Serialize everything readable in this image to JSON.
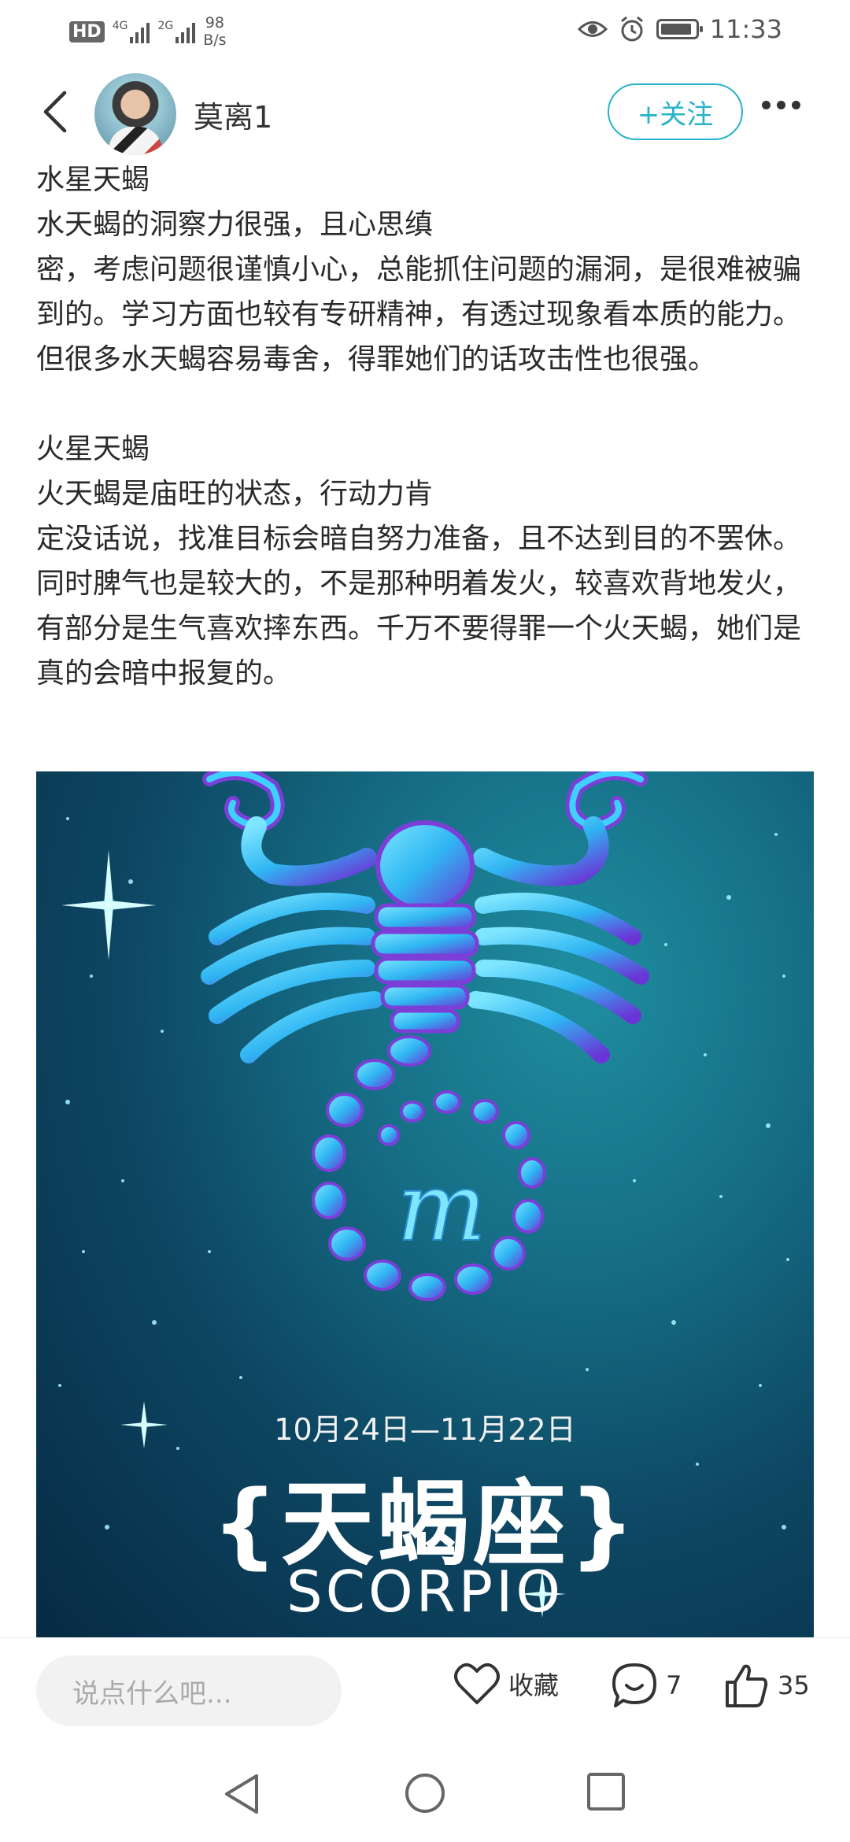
{
  "status_bar": {
    "hd": "HD",
    "sim1_type": "4G",
    "sim2_type": "2G",
    "speed_value": "98",
    "speed_unit": "B/s",
    "time": "11:33"
  },
  "header": {
    "username": "莫离1",
    "follow_label": "+关注"
  },
  "article": {
    "paragraphs": [
      "水星天蝎",
      "水天蝎的洞察力很强，且心思缜",
      "密，考虑问题很谨慎小心，总能抓住问题的漏洞，是很难被骗到的。学习方面也较有专研精神，有透过现象看本质的能力。但很多水天蝎容易毒舍，得罪她们的话攻击性也很强。",
      "火星天蝎",
      "火天蝎是庙旺的状态，行动力肯",
      "定没话说，找准目标会暗自努力准备，且不达到目的不罢休。同时脾气也是较大的，不是那种明着发火，较喜欢背地发火，有部分是生气喜欢摔东西。千万不要得罪一个火天蝎，她们是真的会暗中报复的。"
    ]
  },
  "image": {
    "date_range": "10月24日—11月22日",
    "title_zh": "{天蝎座}",
    "title_en": "SCORPIO",
    "symbol": "m"
  },
  "bottom_bar": {
    "comment_placeholder": "说点什么吧...",
    "favorite_label": "收藏",
    "comment_count": "7",
    "like_count": "35"
  },
  "colors": {
    "accent": "#28b3c8",
    "scorpion_blue": "#2fc8f0",
    "scorpion_purple": "#7b3fd8"
  }
}
